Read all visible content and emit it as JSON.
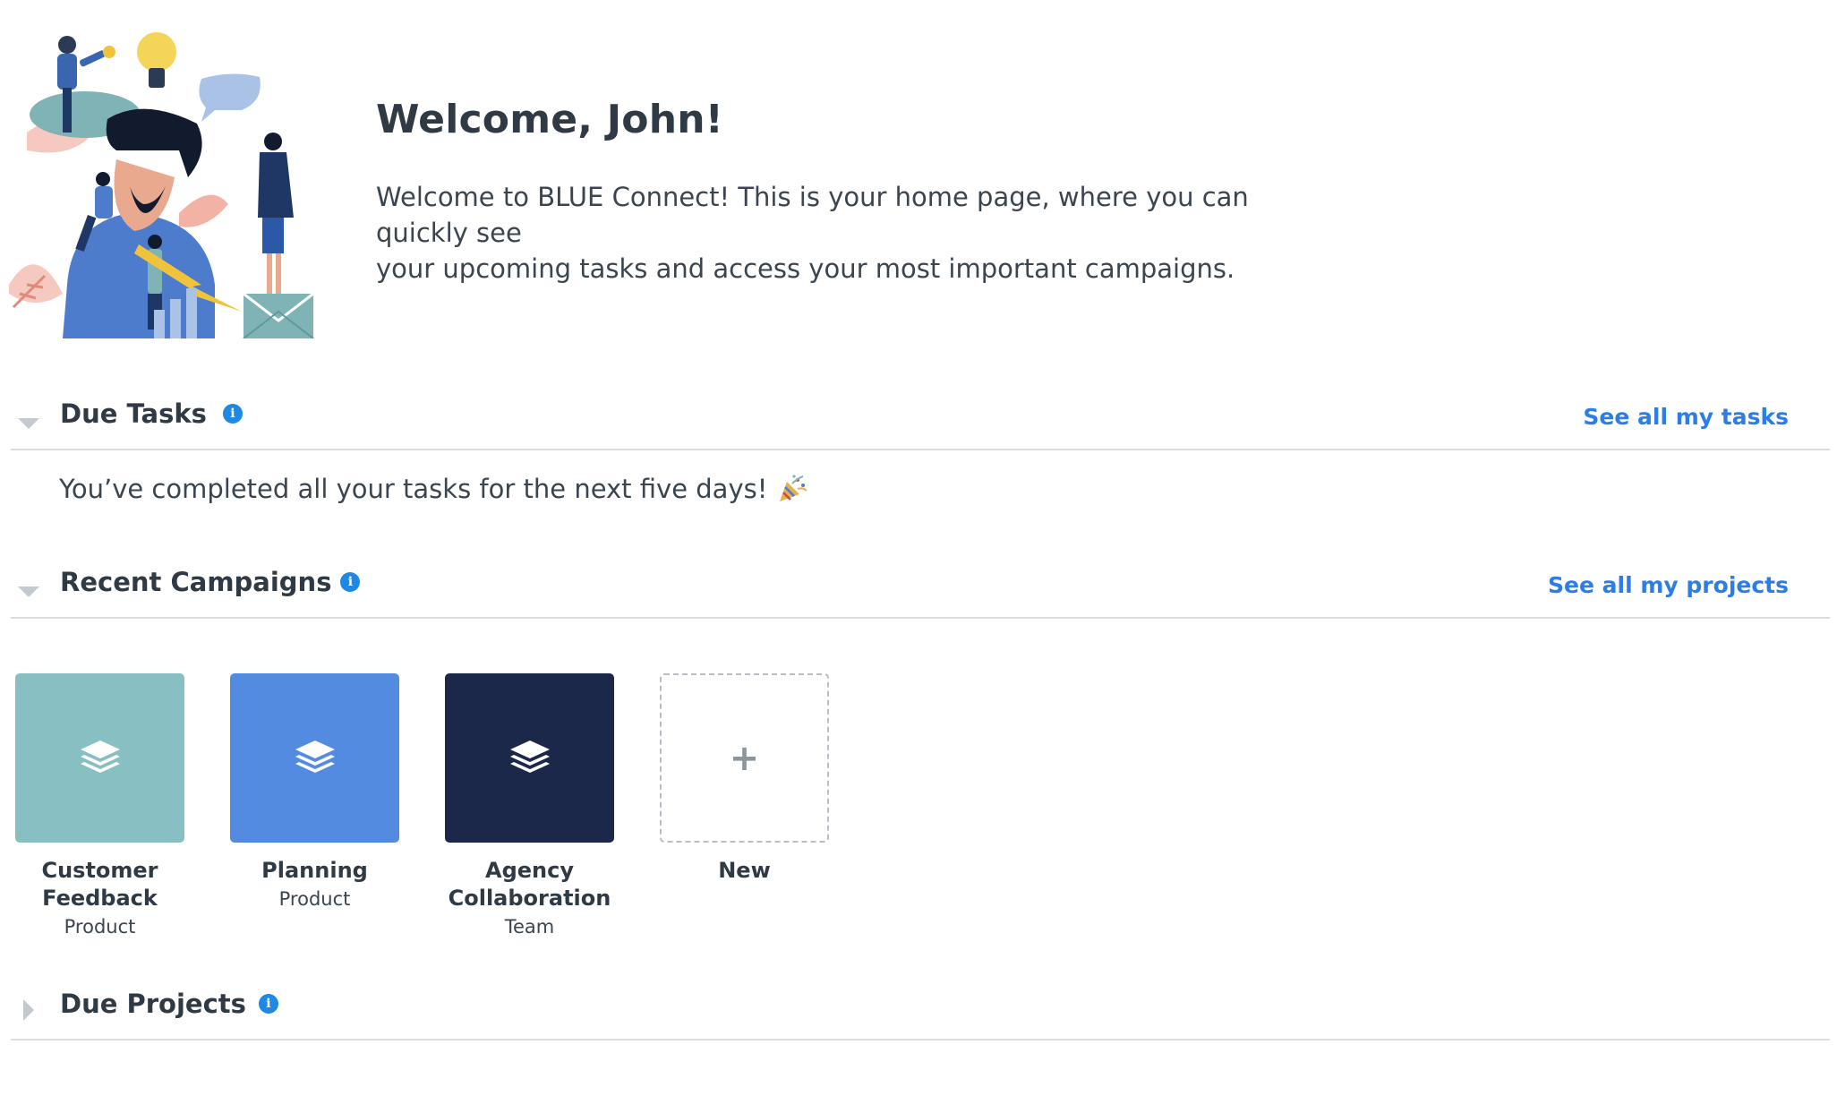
{
  "hero": {
    "title": "Welcome, John!",
    "intro_line1": "Welcome to BLUE Connect! This is your home page, where you can quickly see",
    "intro_line2": "your upcoming tasks and access your most important campaigns."
  },
  "due_tasks": {
    "title": "Due Tasks",
    "link": "See all my tasks",
    "message": "You’ve completed all your tasks for the next five days!",
    "message_icon": "party-popper-icon",
    "expanded": true
  },
  "recent_campaigns": {
    "title": "Recent Campaigns",
    "link": "See all my projects",
    "expanded": true,
    "items": [
      {
        "name_line1": "Customer",
        "name_line2": "Feedback",
        "type": "Product",
        "color": "#87bfc2",
        "icon": "layers-icon"
      },
      {
        "name_line1": "Planning",
        "name_line2": "",
        "type": "Product",
        "color": "#538be0",
        "icon": "layers-icon"
      },
      {
        "name_line1": "Agency",
        "name_line2": "Collaboration",
        "type": "Team",
        "color": "#1b284a",
        "icon": "layers-icon"
      }
    ],
    "new_tile": {
      "label": "New",
      "icon": "plus-icon"
    }
  },
  "due_projects": {
    "title": "Due Projects",
    "expanded": false
  },
  "colors": {
    "link": "#2b7de9",
    "info_icon": "#1e88e5",
    "divider": "#dadde1",
    "heading": "#2f3a45"
  }
}
